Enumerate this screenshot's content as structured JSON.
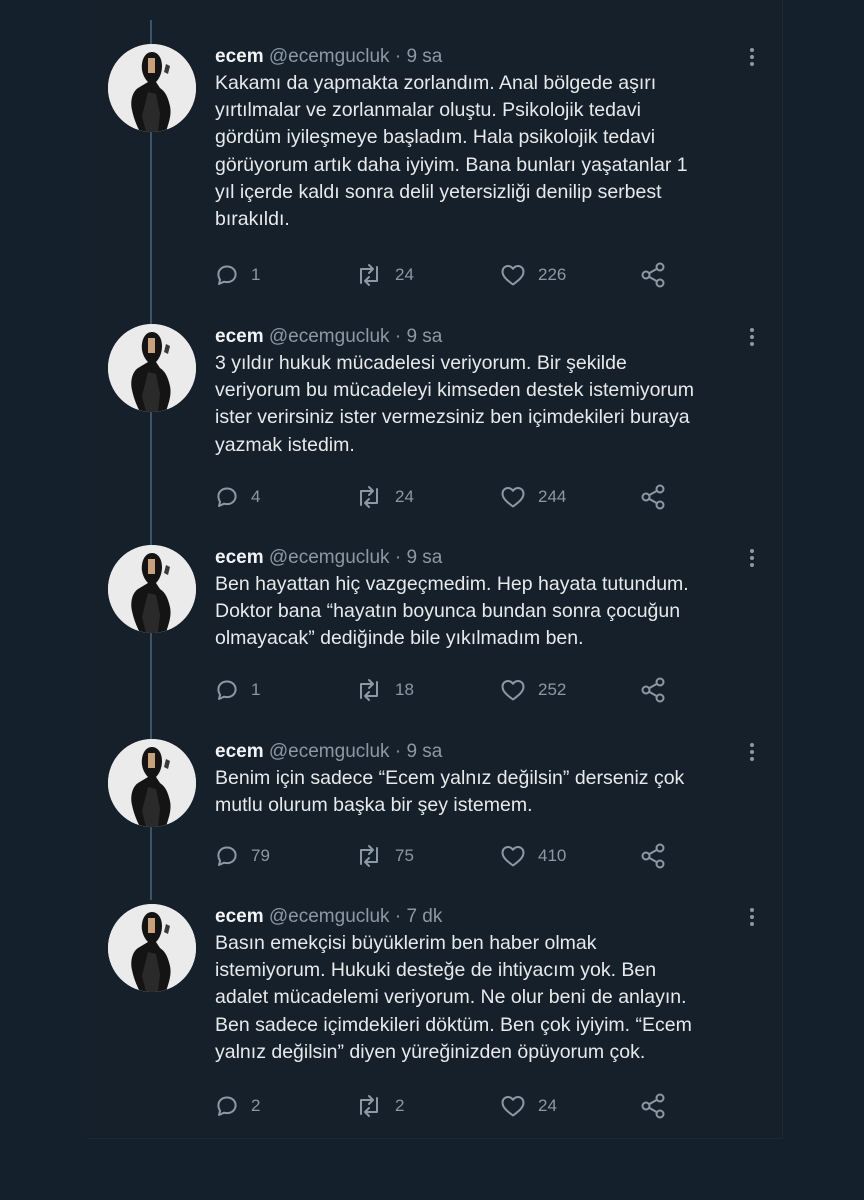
{
  "colors": {
    "background": "#15202b",
    "text": "#e7e9ea",
    "secondary": "#8b98a5",
    "thread_line": "#3d5466"
  },
  "tweets": [
    {
      "name": "ecem",
      "handle": "@ecemgucluk",
      "sep": "·",
      "time": "9 sa",
      "text": "Kakamı da yapmakta zorlandım. Anal bölgede aşırı\nyırtılmalar ve zorlanmalar oluştu. Psikolojik tedavi\ngördüm iyileşmeye başladım. Hala psikolojik tedavi\ngörüyorum artık daha iyiyim. Bana bunları yaşatanlar 1\nyıl içerde kaldı sonra delil yetersizliği denilip serbest\nbırakıldı.",
      "replies": "1",
      "retweets": "24",
      "likes": "226"
    },
    {
      "name": "ecem",
      "handle": "@ecemgucluk",
      "sep": "·",
      "time": "9 sa",
      "text": "3 yıldır hukuk mücadelesi veriyorum. Bir şekilde\nveriyorum bu mücadeleyi kimseden destek istemiyorum\nister verirsiniz ister vermezsiniz ben içimdekileri buraya\nyazmak istedim.",
      "replies": "4",
      "retweets": "24",
      "likes": "244"
    },
    {
      "name": "ecem",
      "handle": "@ecemgucluk",
      "sep": "·",
      "time": "9 sa",
      "text": "Ben hayattan hiç vazgeçmedim. Hep hayata tutundum.\nDoktor bana “hayatın boyunca bundan sonra çocuğun\nolmayacak” dediğinde bile yıkılmadım ben.",
      "replies": "1",
      "retweets": "18",
      "likes": "252"
    },
    {
      "name": "ecem",
      "handle": "@ecemgucluk",
      "sep": "·",
      "time": "9 sa",
      "text": "Benim için sadece “Ecem yalnız değilsin” derseniz çok\nmutlu olurum başka bir şey istemem.",
      "replies": "79",
      "retweets": "75",
      "likes": "410"
    },
    {
      "name": "ecem",
      "handle": "@ecemgucluk",
      "sep": "·",
      "time": "7 dk",
      "text": "Basın emekçisi büyüklerim ben haber olmak\nistemiyorum. Hukuki desteğe de ihtiyacım yok. Ben\nadalet mücadelemi veriyorum. Ne olur beni de anlayın.\nBen sadece içimdekileri döktüm. Ben çok iyiyim. “Ecem\nyalnız değilsin” diyen yüreğinizden öpüyorum çok.",
      "replies": "2",
      "retweets": "2",
      "likes": "24"
    }
  ]
}
